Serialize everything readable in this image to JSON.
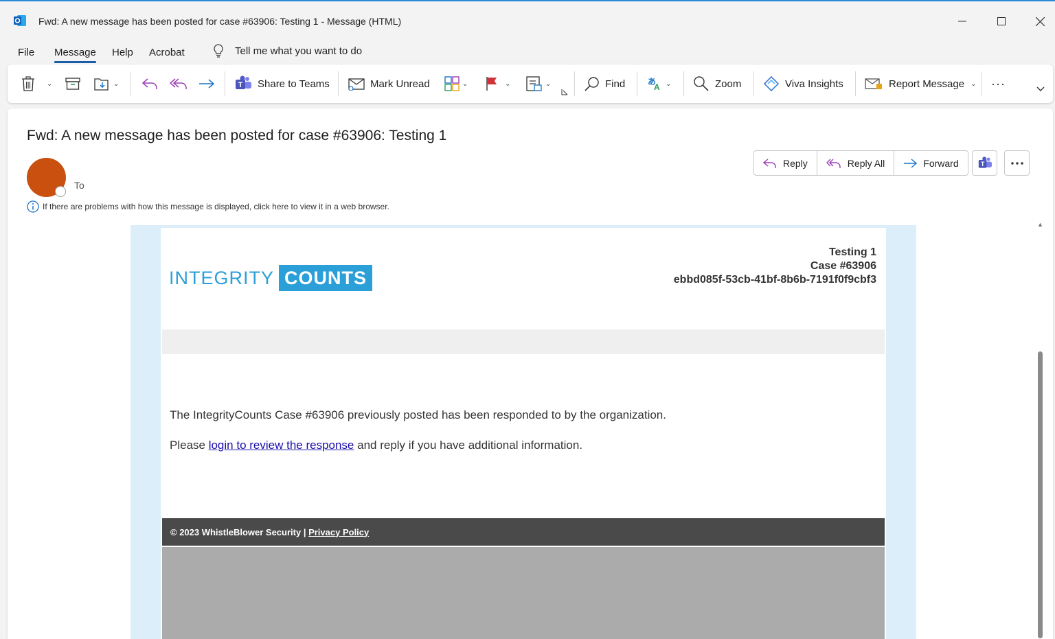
{
  "window": {
    "title": "Fwd: A new message has been posted for case #63906: Testing 1  -  Message (HTML)"
  },
  "menu": {
    "tabs": [
      "File",
      "Message",
      "Help",
      "Acrobat"
    ],
    "tell_me": "Tell me what you want to do"
  },
  "ribbon": {
    "share_to_teams": "Share to Teams",
    "mark_unread": "Mark Unread",
    "find": "Find",
    "zoom": "Zoom",
    "viva_insights": "Viva Insights",
    "report_message": "Report Message",
    "more": "···"
  },
  "message": {
    "subject": "Fwd: A new message has been posted for case #63906: Testing 1",
    "to_label": "To",
    "info_text": "If there are problems with how this message is displayed, click here to view it in a web browser.",
    "actions": {
      "reply": "Reply",
      "reply_all": "Reply All",
      "forward": "Forward"
    }
  },
  "email": {
    "logo_part1": "INTEGRITY",
    "logo_part2": "COUNTS",
    "case_title": "Testing 1",
    "case_number": "Case #63906",
    "case_id": "ebbd085f-53cb-41bf-8b6b-7191f0f9cbf3",
    "line1": "The IntegrityCounts Case #63906 previously posted has been responded to by the organization.",
    "line2_prefix": "Please ",
    "line2_link": "login to review the response",
    "line2_suffix": " and reply if you have additional information.",
    "footer_copyright": "© 2023 WhistleBlower Security",
    "footer_sep": " | ",
    "footer_privacy": "Privacy Policy"
  },
  "colors": {
    "accent": "#1a5ea8",
    "avatar": "#ca5010",
    "logo_blue": "#2a9fd8",
    "email_bg": "#dbeefa",
    "footer": "#4a4a4a"
  }
}
